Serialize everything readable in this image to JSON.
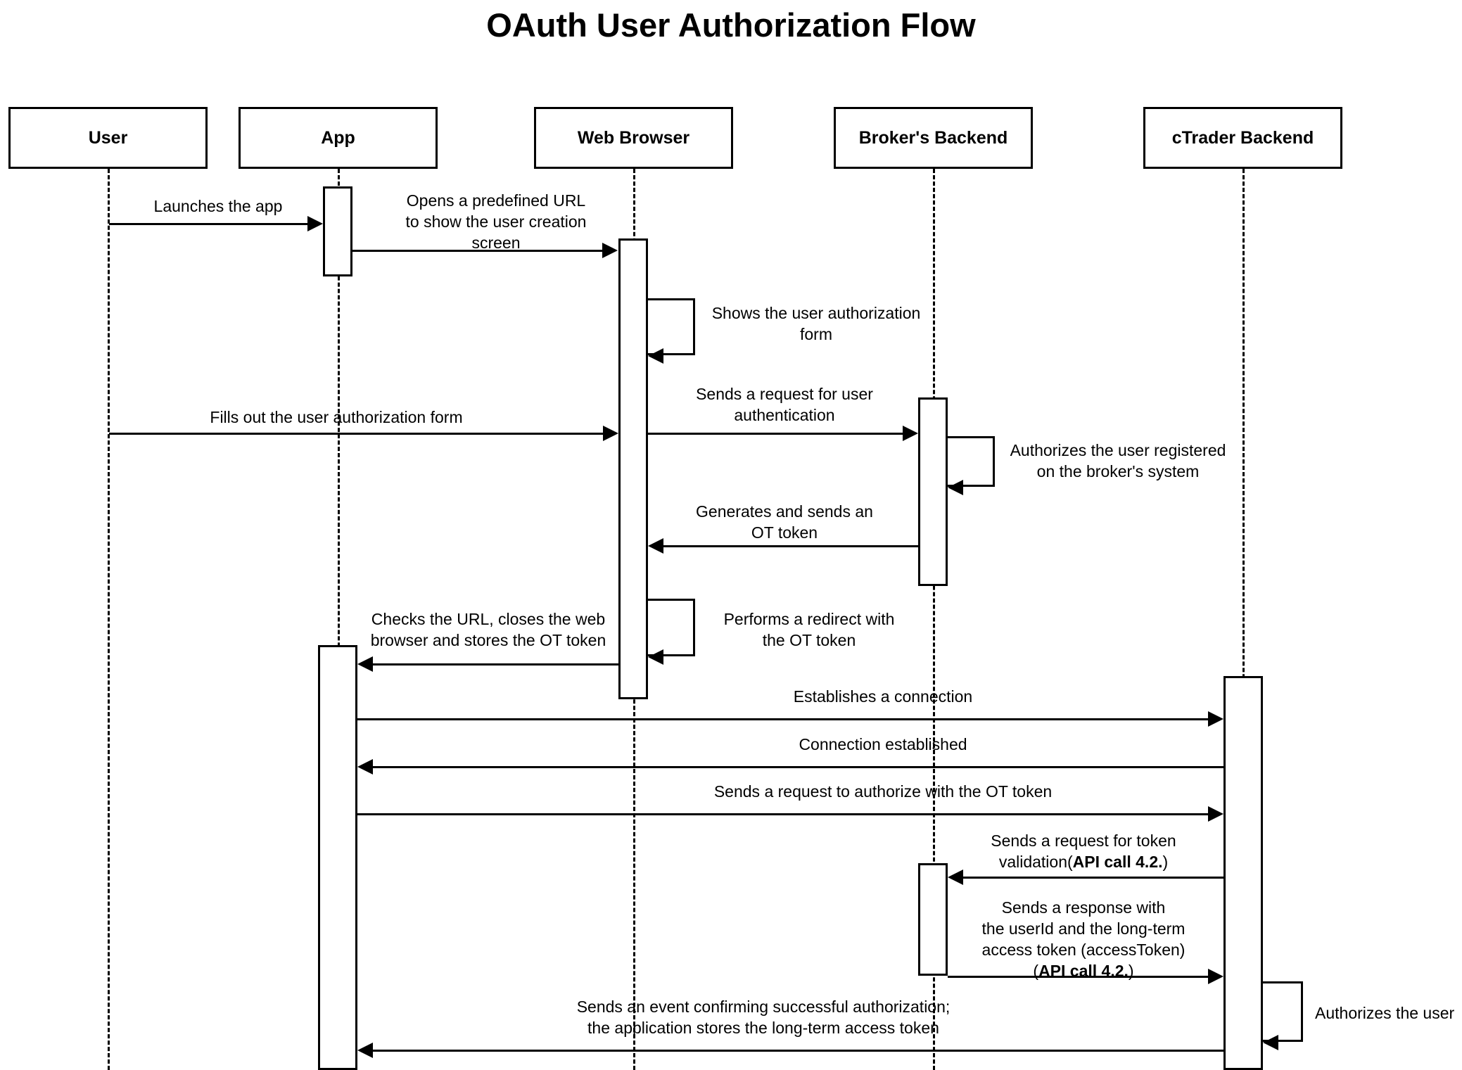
{
  "title": "OAuth User Authorization Flow",
  "participants": [
    {
      "name": "User"
    },
    {
      "name": "App"
    },
    {
      "name": "Web Browser"
    },
    {
      "name": "Broker's Backend"
    },
    {
      "name": "cTrader Backend"
    }
  ],
  "messages": [
    {
      "label": "Launches the app",
      "from": "User",
      "to": "App",
      "direction": "right"
    },
    {
      "label": "Opens a predefined URL\nto show the user creation\nscreen",
      "from": "App",
      "to": "Web Browser",
      "direction": "right"
    },
    {
      "label": "Shows the user authorization\nform",
      "from": "Web Browser",
      "to": "Web Browser",
      "direction": "self"
    },
    {
      "label": "Fills out the user authorization form",
      "from": "User",
      "to": "Web Browser",
      "direction": "right"
    },
    {
      "label": "Sends a request for user\nauthentication",
      "from": "Web Browser",
      "to": "Broker's Backend",
      "direction": "right"
    },
    {
      "label": "Authorizes the user registered\non the broker's system",
      "from": "Broker's Backend",
      "to": "Broker's Backend",
      "direction": "self"
    },
    {
      "label": "Generates and sends an\nOT token",
      "from": "Broker's Backend",
      "to": "Web Browser",
      "direction": "left"
    },
    {
      "label": "Performs a redirect with\nthe OT token",
      "from": "Web Browser",
      "to": "Web Browser",
      "direction": "self"
    },
    {
      "label": "Checks the URL, closes the web\nbrowser and stores the OT token",
      "from": "Web Browser",
      "to": "App",
      "direction": "left"
    },
    {
      "label": "Establishes a connection",
      "from": "App",
      "to": "cTrader Backend",
      "direction": "right"
    },
    {
      "label": "Connection established",
      "from": "cTrader Backend",
      "to": "App",
      "direction": "left"
    },
    {
      "label": "Sends a request to authorize with the OT token",
      "from": "App",
      "to": "cTrader Backend",
      "direction": "right"
    },
    {
      "label": "Sends a request for token\nvalidation(",
      "label_bold": "API call 4.2.",
      "label_tail": ")",
      "from": "cTrader Backend",
      "to": "Broker's Backend",
      "direction": "left"
    },
    {
      "label": "Sends a response with\nthe userId and the long-term\naccess token (accessToken)\n(",
      "label_bold": "API call 4.2.",
      "label_tail": ")",
      "from": "Broker's Backend",
      "to": "cTrader Backend",
      "direction": "right"
    },
    {
      "label": "Authorizes the user",
      "from": "cTrader Backend",
      "to": "cTrader Backend",
      "direction": "self"
    },
    {
      "label": "Sends an event confirming successful authorization;\nthe application stores the long-term access token",
      "from": "cTrader Backend",
      "to": "App",
      "direction": "left"
    }
  ],
  "labels": {
    "m1": "Launches the app",
    "m2": "Opens a predefined URL\nto show the user creation\nscreen",
    "m3": "Shows the user authorization\nform",
    "m4": "Fills out the user authorization form",
    "m5": "Sends a request for user\nauthentication",
    "m6": "Authorizes the user registered\non the broker's system",
    "m7": "Generates and sends an\nOT token",
    "m8": "Performs a redirect with\nthe OT token",
    "m9": "Checks the URL, closes the web\nbrowser and stores the OT token",
    "m10": "Establishes a connection",
    "m11": "Connection established",
    "m12": "Sends a request to authorize with the OT token",
    "m13_pre": "Sends a request for token\nvalidation(",
    "m13_bold": "API call 4.2.",
    "m13_post": ")",
    "m14_pre": "Sends a response with\nthe userId and the long-term\naccess token (accessToken)\n(",
    "m14_bold": "API call 4.2.",
    "m14_post": ")",
    "m15": "Authorizes the user",
    "m16": "Sends an event confirming successful authorization;\nthe application stores the long-term access token"
  },
  "participant_names": {
    "p0": "User",
    "p1": "App",
    "p2": "Web Browser",
    "p3": "Broker's Backend",
    "p4": "cTrader Backend"
  },
  "colors": {
    "stroke": "#000000",
    "background": "#ffffff"
  }
}
